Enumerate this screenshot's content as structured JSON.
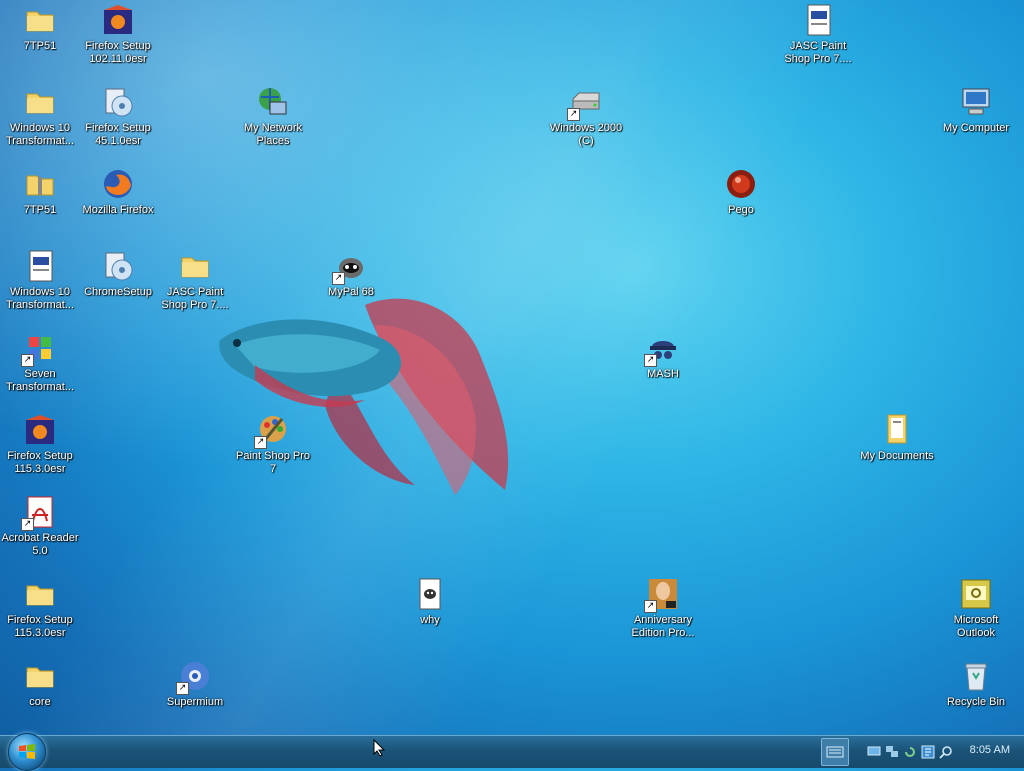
{
  "desktop": {
    "icons": [
      {
        "label": "7TP51",
        "icon": "folder-icon"
      },
      {
        "label": "Firefox Setup 102.11.0esr",
        "icon": "installer-icon"
      },
      {
        "label": "JASC Paint Shop Pro 7....",
        "icon": "document-icon"
      },
      {
        "label": "Windows 10 Transformat...",
        "icon": "folder-icon"
      },
      {
        "label": "Firefox Setup 45.1.0esr",
        "icon": "setup-icon"
      },
      {
        "label": "My Network Places",
        "icon": "network-places-icon"
      },
      {
        "label": "Windows 2000 (C)",
        "icon": "drive-icon"
      },
      {
        "label": "My Computer",
        "icon": "computer-icon"
      },
      {
        "label": "7TP51",
        "icon": "zip-folder-icon"
      },
      {
        "label": "Mozilla Firefox",
        "icon": "firefox-icon"
      },
      {
        "label": "Pego",
        "icon": "pego-icon"
      },
      {
        "label": "Windows 10 Transformat...",
        "icon": "document-icon"
      },
      {
        "label": "ChromeSetup",
        "icon": "setup-icon"
      },
      {
        "label": "JASC Paint Shop Pro 7....",
        "icon": "folder-icon"
      },
      {
        "label": "MyPal 68",
        "icon": "mypal-icon"
      },
      {
        "label": "Seven Transformat...",
        "icon": "seven-icon"
      },
      {
        "label": "MASH",
        "icon": "mash-icon"
      },
      {
        "label": "Firefox Setup 115.3.0esr",
        "icon": "installer-icon"
      },
      {
        "label": "Paint Shop Pro 7",
        "icon": "paint-shop-icon"
      },
      {
        "label": "My Documents",
        "icon": "documents-folder-icon"
      },
      {
        "label": "Acrobat Reader 5.0",
        "icon": "acrobat-icon"
      },
      {
        "label": "Firefox Setup 115.3.0esr",
        "icon": "folder-icon"
      },
      {
        "label": "why",
        "icon": "file-icon"
      },
      {
        "label": "Anniversary Edition Pro...",
        "icon": "anniversary-icon"
      },
      {
        "label": "Microsoft Outlook",
        "icon": "outlook-icon"
      },
      {
        "label": "core",
        "icon": "folder-icon"
      },
      {
        "label": "Supermium",
        "icon": "supermium-icon"
      },
      {
        "label": "Recycle Bin",
        "icon": "recycle-bin-icon"
      }
    ]
  },
  "taskbar": {
    "start_icon": "windows-start-icon",
    "clock": "8:05 AM"
  }
}
